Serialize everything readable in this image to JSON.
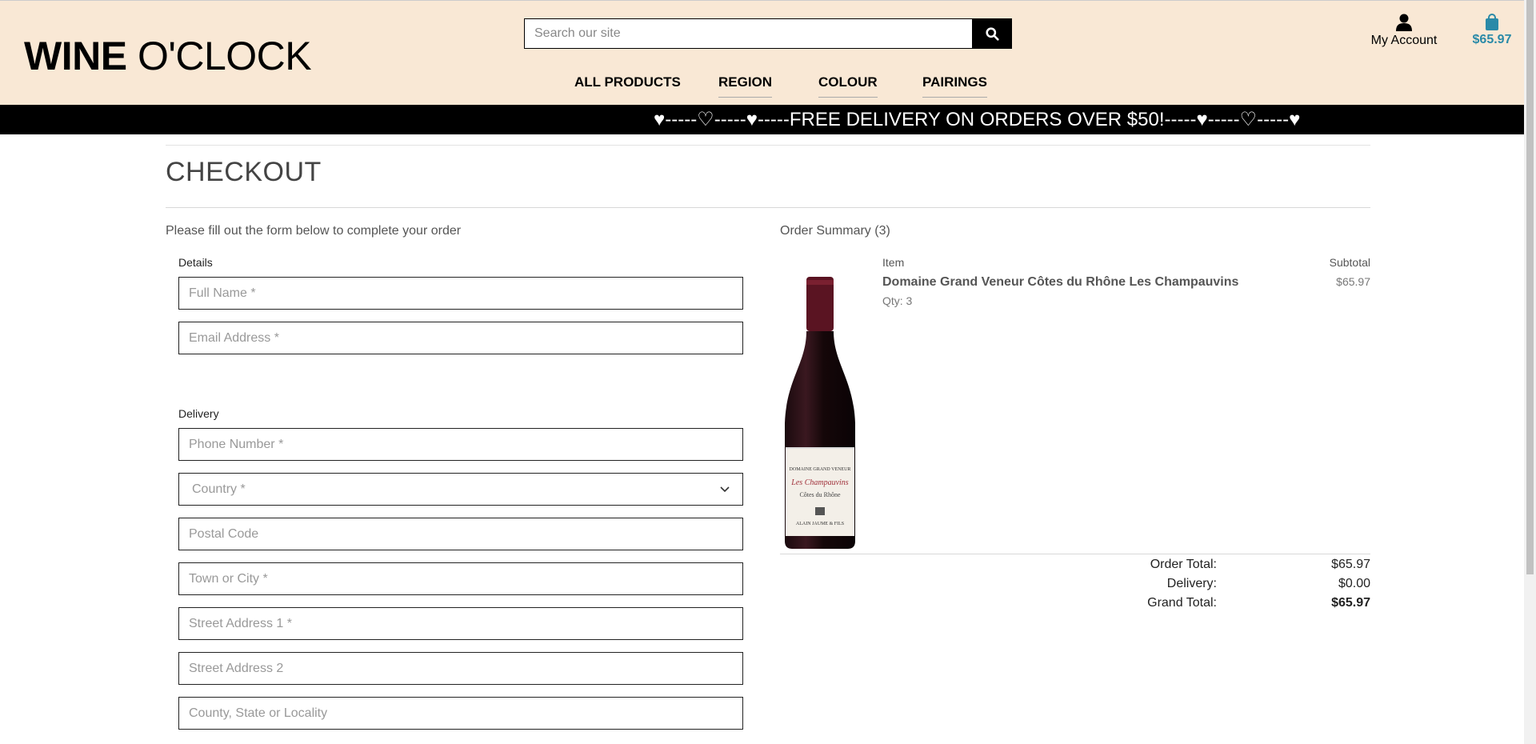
{
  "header": {
    "logo_bold": "WINE",
    "logo_rest": " O'CLOCK",
    "search_placeholder": "Search our site",
    "nav": [
      "ALL PRODUCTS",
      "REGION",
      "COLOUR",
      "PAIRINGS"
    ],
    "account_label": "My Account",
    "bag_total": "$65.97",
    "icons": [
      "search-icon",
      "user-icon",
      "shopping-bag-icon"
    ],
    "bag_color": "#2a8aa8"
  },
  "banner": {
    "text": "♥-----♡-----♥-----FREE DELIVERY ON ORDERS OVER $50!-----♥-----♡-----♥"
  },
  "checkout": {
    "title": "CHECKOUT",
    "intro": "Please fill out the form below to complete your order",
    "details_label": "Details",
    "delivery_label": "Delivery",
    "fields": {
      "full_name": "Full Name *",
      "email": "Email Address *",
      "phone": "Phone Number *",
      "country": "Country *",
      "postal_code": "Postal Code",
      "town": "Town or City *",
      "street1": "Street Address 1 *",
      "street2": "Street Address 2",
      "county": "County, State or Locality"
    }
  },
  "summary": {
    "title": "Order Summary (3)",
    "col_item": "Item",
    "col_subtotal": "Subtotal",
    "product": {
      "name": "Domaine Grand Veneur Côtes du Rhône Les Champauvins",
      "qty": "Qty: 3",
      "price": "$65.97",
      "label_lines": [
        "DOMAINE GRAND VENEUR",
        "Les Champauvins",
        "Côtes du Rhône",
        "ALAIN JAUME & FILS"
      ]
    },
    "totals": [
      {
        "label": "Order Total:",
        "value": "$65.97"
      },
      {
        "label": "Delivery:",
        "value": "$0.00"
      },
      {
        "label": "Grand Total:",
        "value": "$65.97"
      }
    ]
  }
}
